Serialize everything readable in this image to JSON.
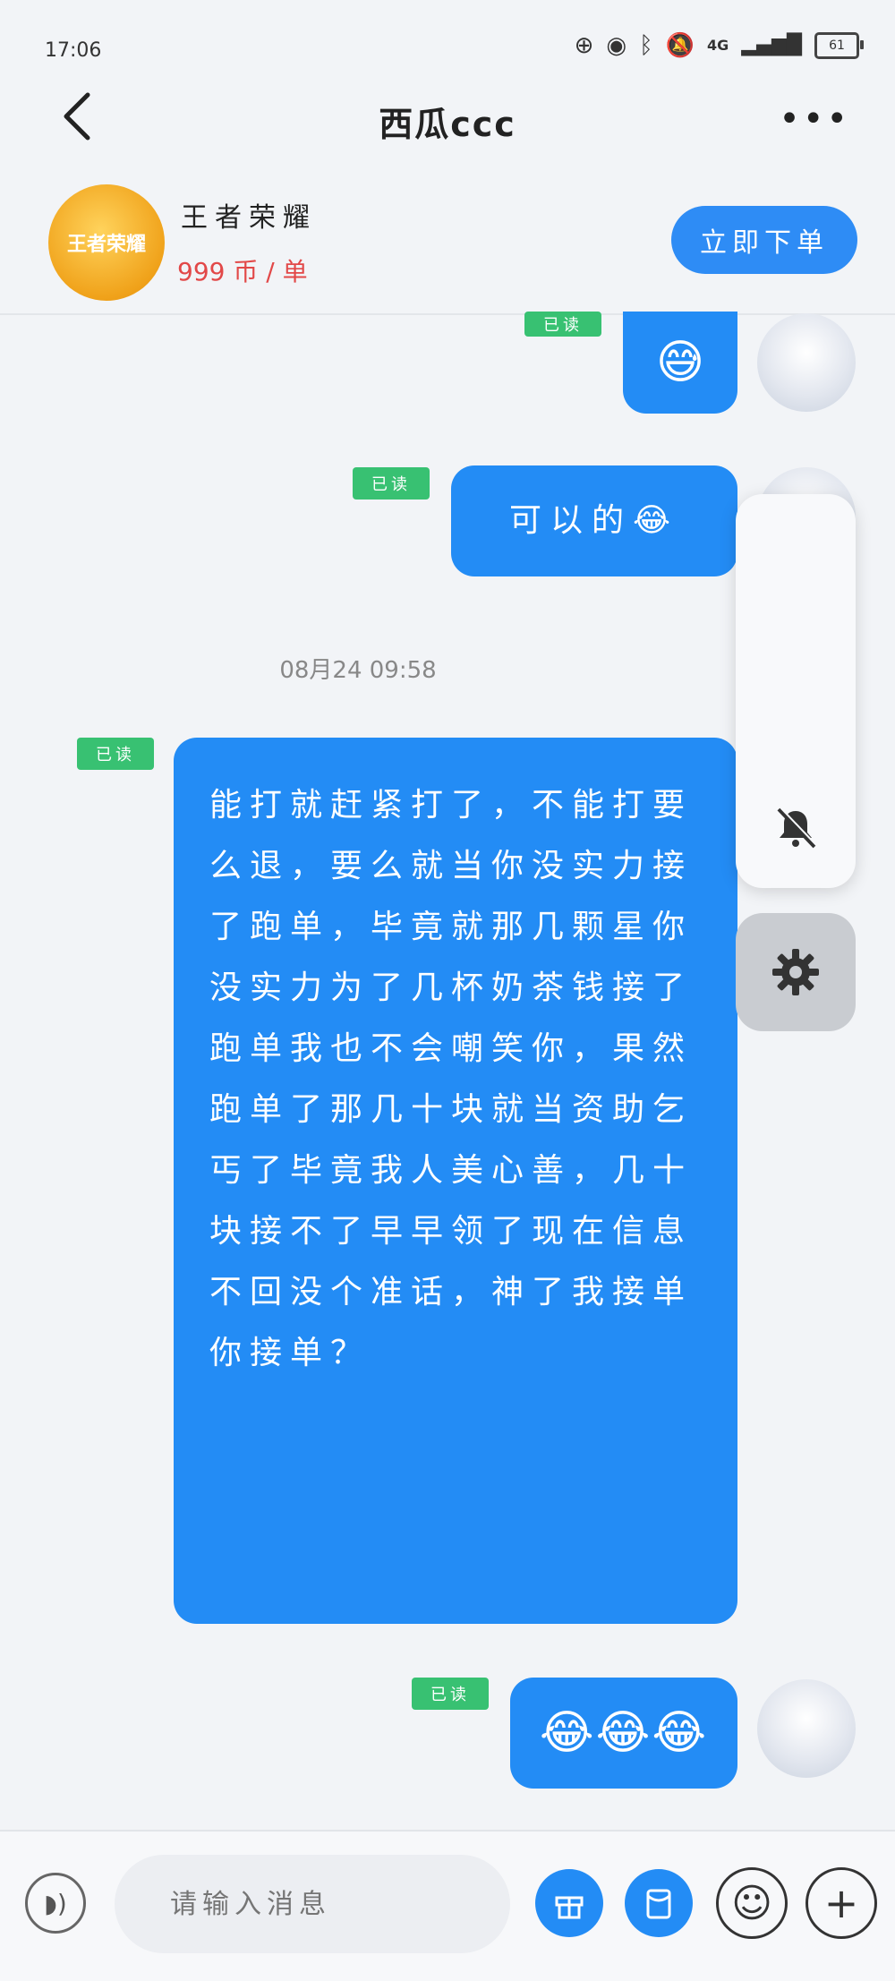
{
  "status_bar": {
    "time": "17:06",
    "network": "4G",
    "battery": "61"
  },
  "header": {
    "title": "西瓜ccc",
    "more_label": "•••"
  },
  "product": {
    "logo_text": "王者荣耀",
    "name": "王者荣耀",
    "price": "999 币 / 单",
    "order_button": "立即下单"
  },
  "messages": [
    {
      "status": "已读",
      "content": "😅"
    },
    {
      "status": "已读",
      "content": "可以的😂"
    },
    {
      "status": "已读",
      "content": "能打就赶紧打了，不能打要么退，要么就当你没实力接了跑单，毕竟就那几颗星你没实力为了几杯奶茶钱接了跑单我也不会嘲笑你，果然跑单了那几十块就当资助乞丐了毕竟我人美心善，几十块接不了早早领了现在信息不回没个准话，神了我接单你接单？"
    },
    {
      "status": "已读",
      "content": "😂😂😂"
    }
  ],
  "timestamp": "08月24 09:58",
  "input": {
    "placeholder": "请输入消息"
  },
  "colors": {
    "bubble": "#238cf5",
    "read_badge": "#38c172",
    "price": "#e24848"
  },
  "icons": [
    "back-icon",
    "more-icon",
    "mute-icon",
    "settings-icon",
    "voice-icon",
    "gift-icon",
    "red-packet-icon",
    "emoji-icon",
    "plus-icon"
  ]
}
